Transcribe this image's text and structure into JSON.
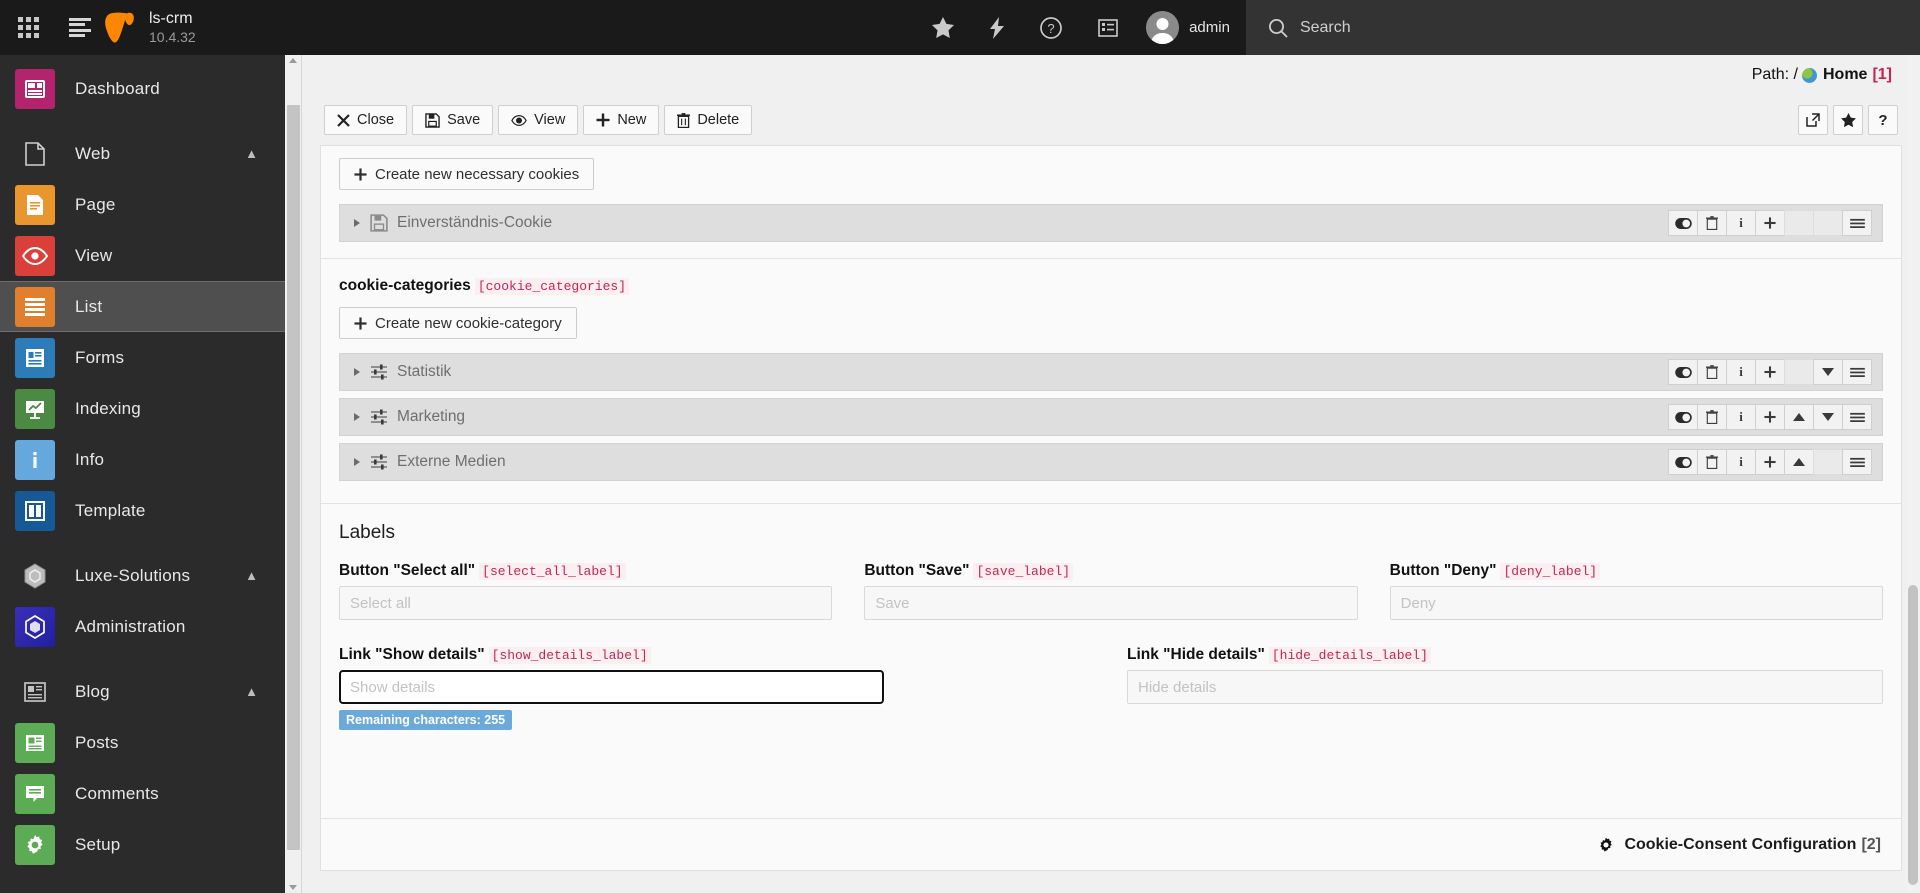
{
  "topbar": {
    "module_menu_icon": "apps-grid-icon",
    "list_icon": "list-view-icon",
    "site_name": "ls-crm",
    "version": "10.4.32",
    "actions": [
      {
        "name": "bookmarks-star-icon",
        "glyph": "★"
      },
      {
        "name": "clear-cache-bolt-icon",
        "glyph": "⚡"
      },
      {
        "name": "help-question-icon",
        "glyph": "?"
      },
      {
        "name": "system-information-icon",
        "glyph": "☰"
      }
    ],
    "username": "admin",
    "search_placeholder": "Search"
  },
  "sidebar": {
    "items": [
      {
        "label": "Dashboard",
        "icon": "dashboard-icon",
        "type": "module",
        "color": "#b4236e",
        "active": false
      },
      {
        "label": "Web",
        "icon": "page-blank-icon",
        "type": "group",
        "expanded": true
      },
      {
        "label": "Page",
        "icon": "page-icon",
        "type": "module",
        "color": "#e8962d",
        "active": false
      },
      {
        "label": "View",
        "icon": "eye-icon",
        "type": "module",
        "color": "#d9403a",
        "active": false
      },
      {
        "label": "List",
        "icon": "list-icon",
        "type": "module",
        "color": "#e0802f",
        "active": true
      },
      {
        "label": "Forms",
        "icon": "forms-icon",
        "type": "module",
        "color": "#2b7cb8",
        "active": false
      },
      {
        "label": "Indexing",
        "icon": "indexing-chart-icon",
        "type": "module",
        "color": "#4b8a43",
        "active": false
      },
      {
        "label": "Info",
        "icon": "info-icon",
        "type": "module",
        "color": "#64a8dd",
        "active": false
      },
      {
        "label": "Template",
        "icon": "template-icon",
        "type": "module",
        "color": "#155a96",
        "active": false
      },
      {
        "label": "Luxe-Solutions",
        "icon": "luxe-hex-icon",
        "type": "group",
        "expanded": true
      },
      {
        "label": "Administration",
        "icon": "administration-hex-icon",
        "type": "module",
        "color": "#2b2ba8",
        "active": false
      },
      {
        "label": "Blog",
        "icon": "blog-news-icon",
        "type": "group",
        "expanded": true
      },
      {
        "label": "Posts",
        "icon": "posts-icon",
        "type": "module",
        "color": "#5cab55",
        "active": false
      },
      {
        "label": "Comments",
        "icon": "comments-icon",
        "type": "module",
        "color": "#5cab55",
        "active": false
      },
      {
        "label": "Setup",
        "icon": "setup-gear-icon",
        "type": "module",
        "color": "#5cab55",
        "active": false
      }
    ]
  },
  "main": {
    "path": {
      "prefix": "Path: /",
      "page_title": "Home",
      "page_uid": "[1]",
      "icon": "globe-icon"
    },
    "toolbar": {
      "buttons": [
        {
          "label": "Close",
          "icon": "close-x-icon"
        },
        {
          "label": "Save",
          "icon": "save-floppy-icon"
        },
        {
          "label": "View",
          "icon": "view-eye-icon"
        },
        {
          "label": "New",
          "icon": "new-plus-icon"
        },
        {
          "label": "Delete",
          "icon": "delete-trash-icon"
        }
      ],
      "right_buttons": [
        {
          "name": "open-in-new-window-button",
          "icon": "external-link-icon"
        },
        {
          "name": "bookmark-button",
          "icon": "star-icon"
        },
        {
          "name": "help-button",
          "icon": "question-mark-icon"
        }
      ]
    },
    "necessary_cookies": {
      "create_label": "Create new necessary cookies",
      "records": [
        {
          "title": "Einverständnis-Cookie",
          "icon": "cookie-record-icon",
          "actions": [
            "toggle-visibility",
            "delete",
            "info",
            "new",
            "empty",
            "empty",
            "drag-handle"
          ]
        }
      ]
    },
    "cookie_categories": {
      "group_title": "cookie-categories",
      "group_code": "[cookie_categories]",
      "create_label": "Create new cookie-category",
      "records": [
        {
          "title": "Statistik",
          "icon": "sliders-icon",
          "actions": [
            "toggle-visibility",
            "delete",
            "info",
            "new",
            "empty",
            "move-down",
            "drag-handle"
          ]
        },
        {
          "title": "Marketing",
          "icon": "sliders-icon",
          "actions": [
            "toggle-visibility",
            "delete",
            "info",
            "new",
            "move-up",
            "move-down",
            "drag-handle"
          ]
        },
        {
          "title": "Externe Medien",
          "icon": "sliders-icon",
          "actions": [
            "toggle-visibility",
            "delete",
            "info",
            "new",
            "move-up",
            "empty",
            "drag-handle"
          ]
        }
      ]
    },
    "labels_section": {
      "heading": "Labels",
      "fields_row1": [
        {
          "label": "Button \"Select all\"",
          "code": "[select_all_label]",
          "value": "",
          "placeholder": "Select all",
          "focused": false
        },
        {
          "label": "Button \"Save\"",
          "code": "[save_label]",
          "value": "",
          "placeholder": "Save",
          "focused": false
        },
        {
          "label": "Button \"Deny\"",
          "code": "[deny_label]",
          "value": "",
          "placeholder": "Deny",
          "focused": false
        }
      ],
      "fields_row2": [
        {
          "label": "Link \"Show details\"",
          "code": "[show_details_label]",
          "value": "",
          "placeholder": "Show details",
          "focused": true,
          "counter": "Remaining characters: 255"
        },
        {
          "label": "Link \"Hide details\"",
          "code": "[hide_details_label]",
          "value": "",
          "placeholder": "Hide details",
          "focused": false
        }
      ]
    },
    "footer": {
      "icon": "gear-icon",
      "title": "Cookie-Consent Configuration",
      "uid": "[2]"
    }
  },
  "colors": {
    "topbar_bg": "#1a1a1a",
    "sidebar_bg": "#2b2b2b",
    "accent_orange": "#ff8700",
    "code_pink": "#c7254e",
    "counter_blue": "#6aa9d8"
  }
}
